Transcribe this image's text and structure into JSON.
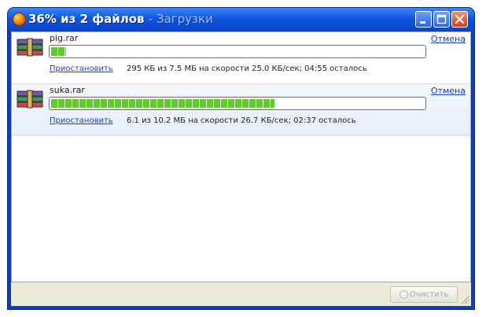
{
  "window": {
    "title": "36% из 2 файлов",
    "title_suffix": "- Загрузки"
  },
  "downloads": [
    {
      "filename": "pig.rar",
      "progress_percent": 4,
      "pause_label": "Приостановить",
      "status": "295 КБ из 7.5 МБ на скорости 25.0 КБ/сек; 04:55 осталось",
      "cancel_label": "Отмена",
      "selected": false
    },
    {
      "filename": "suka.rar",
      "progress_percent": 60,
      "pause_label": "Приостановить",
      "status": "6.1 из 10.2 МБ на скорости 26.7 КБ/сек; 02:37 осталось",
      "cancel_label": "Отмена",
      "selected": true
    }
  ],
  "footer": {
    "clear_label": "Очистить"
  },
  "colors": {
    "titlebar": "#0f55e0",
    "progress_fill": "#62c92a",
    "link": "#1a3fbf"
  }
}
